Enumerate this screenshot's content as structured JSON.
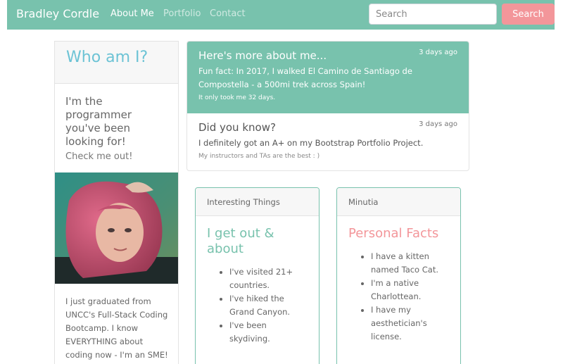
{
  "nav": {
    "brand": "Bradley Cordle",
    "links": [
      "About Me",
      "Portfolio",
      "Contact"
    ],
    "search_placeholder": "Search",
    "search_button": "Search"
  },
  "profile": {
    "title": "Who am I?",
    "tagline": "I'm the programmer you've been looking for!",
    "subtagline": "Check me out!",
    "photo": "portrait-photo",
    "bio": "I just graduated from UNCC's Full-Stack Coding Bootcamp. I know EVERYTHING about coding now - I'm an SME!"
  },
  "news": [
    {
      "heading": "Here's more about me...",
      "time": "3 days ago",
      "text": "Fun fact: In 2017, I walked El Camino de Santiago de Compostella - a 500mi trek across Spain!",
      "footer": "It only took me 32 days."
    },
    {
      "heading": "Did you know?",
      "time": "3 days ago",
      "text": "I definitely got an A+ on my Bootstrap Portfolio Project.",
      "footer": "My instructors and TAs are the best : )"
    }
  ],
  "cards": [
    {
      "header": "Interesting Things",
      "title": "I get out & about",
      "items": [
        "I've visited 21+ countries.",
        "I've hiked the Grand Canyon.",
        "I've been skydiving."
      ]
    },
    {
      "header": "Minutia",
      "title": "Personal Facts",
      "items": [
        "I have a kitten named Taco Cat.",
        "I'm a native Charlottean.",
        "I have my aesthetician's license."
      ]
    }
  ],
  "colors": {
    "primary": "#78c2ad",
    "secondary": "#f3969a",
    "info": "#6cc3d5"
  }
}
